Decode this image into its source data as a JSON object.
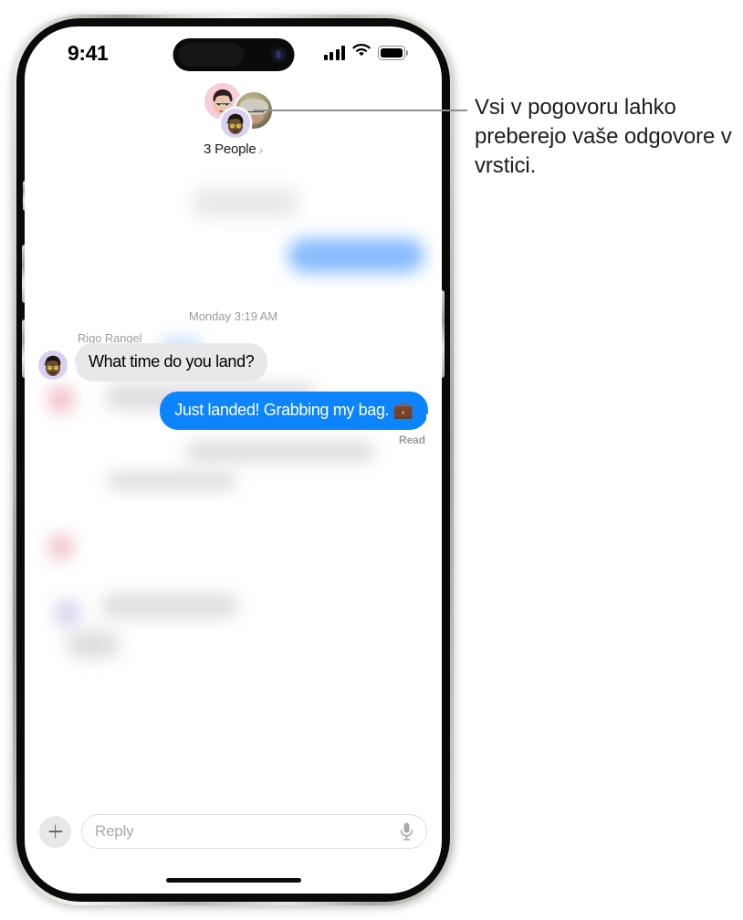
{
  "status_bar": {
    "time": "9:41",
    "signal_icon": "cellular-signal-icon",
    "wifi_icon": "wifi-icon",
    "battery_icon": "battery-icon"
  },
  "chat_header": {
    "participants_label": "3 People",
    "chevron": "›",
    "avatars": [
      {
        "name": "avatar-memoji-pink",
        "bg": "#f6cdd8"
      },
      {
        "name": "avatar-photo-person",
        "bg": "#a9a27a"
      },
      {
        "name": "avatar-memoji-lavender",
        "bg": "#d9d0f2"
      }
    ]
  },
  "thread": {
    "timestamp": "Monday 3:19 AM",
    "incoming": {
      "sender": "Rigo Rangel",
      "text": "What time do you land?",
      "bubble_color": "#e8e8ea",
      "text_color": "#000000"
    },
    "outgoing": {
      "text": "Just landed! Grabbing my bag. 💼",
      "bubble_color": "#0b84fe",
      "text_color": "#ffffff",
      "receipt": "Read"
    }
  },
  "input_bar": {
    "add_label": "+",
    "reply_placeholder": "Reply",
    "mic_icon": "microphone-icon"
  },
  "callout": {
    "text": "Vsi v pogovoru lahko preberejo vaše odgovore v vrstici.",
    "line_color": "#8e8e93"
  }
}
